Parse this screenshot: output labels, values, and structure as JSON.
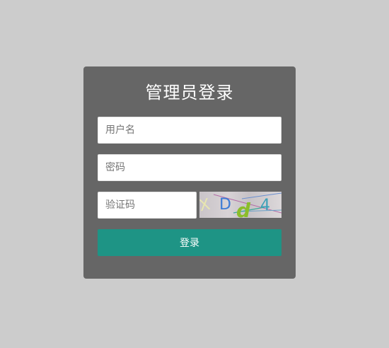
{
  "login": {
    "title": "管理员登录",
    "username_placeholder": "用户名",
    "password_placeholder": "密码",
    "captcha_placeholder": "验证码",
    "captcha_code": [
      "X",
      "D",
      "d",
      "4"
    ],
    "submit_label": "登录"
  },
  "colors": {
    "page_background": "#cccccc",
    "panel_background": "#666666",
    "button_background": "#1e9485",
    "title_text": "#ffffff"
  }
}
